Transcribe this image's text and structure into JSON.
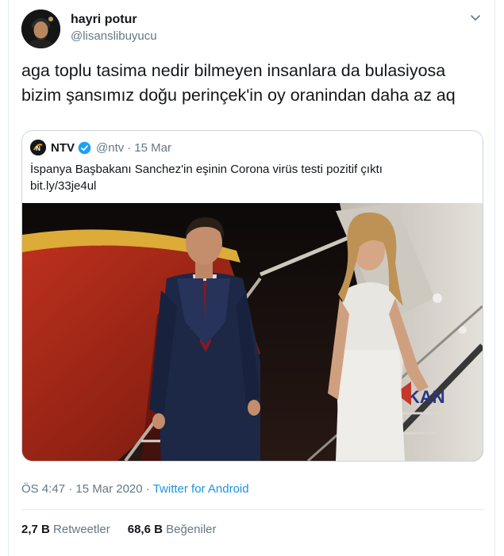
{
  "author": {
    "display_name": "hayri potur",
    "handle": "@lisanslibuyucu"
  },
  "tweet": {
    "text": "aga toplu tasima nedir bilmeyen insanlara da bulasiyosa bizim şansımız doğu perinçek'in oy oranindan daha az aq"
  },
  "quoted_tweet": {
    "name": "NTV",
    "handle": "@ntv",
    "separator": "·",
    "date": "15 Mar",
    "text": "İspanya Başbakanı Sanchez'in eşinin Corona virüs testi pozitif çıktı",
    "link": "bit.ly/33je4ul",
    "photo_sign_text": "KAN",
    "logo_text": "N"
  },
  "meta": {
    "time": "ÖS 4:47",
    "separator1": "·",
    "date": "15 Mar 2020",
    "separator2": "·",
    "source": "Twitter for Android"
  },
  "stats": {
    "retweets_count": "2,7 B",
    "retweets_label": "Retweetler",
    "likes_count": "68,6 B",
    "likes_label": "Beğeniler"
  },
  "colors": {
    "link": "#1b95e0",
    "muted": "#657786",
    "verified": "#1da1f2"
  }
}
